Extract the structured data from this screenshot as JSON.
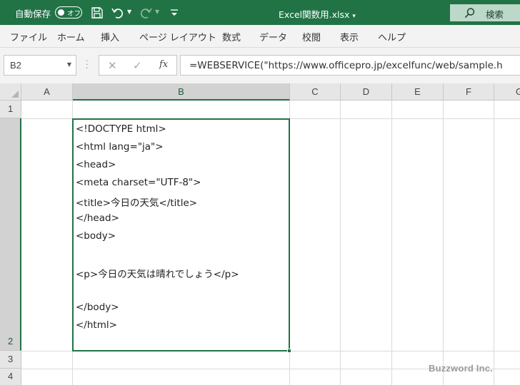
{
  "titlebar": {
    "autosave_label": "自動保存",
    "autosave_state": "オフ",
    "filename": "Excel関数用.xlsx",
    "filename_dropdown": "▾",
    "search_label": "検索",
    "colors": {
      "bg": "#217346",
      "search_bg": "#bcd8c8"
    }
  },
  "menu": {
    "items": [
      "ファイル",
      "ホーム",
      "挿入",
      "ページ レイアウト",
      "数式",
      "データ",
      "校閲",
      "表示",
      "ヘルプ"
    ]
  },
  "formula_bar": {
    "name_box": "B2",
    "cancel_icon": "✕",
    "enter_icon": "✓",
    "fx_label": "fx",
    "formula": "=WEBSERVICE(\"https://www.officepro.jp/excelfunc/web/sample.h"
  },
  "grid": {
    "columns": [
      "A",
      "B",
      "C",
      "D",
      "E",
      "F",
      "G"
    ],
    "selected_column": "B",
    "rows": [
      "1",
      "2",
      "3",
      "4"
    ],
    "selected_row": "2",
    "accent_color": "#217346"
  },
  "cell_B2": {
    "lines": [
      "<!DOCTYPE html>",
      "<html lang=\"ja\">",
      "<head>",
      "<meta charset=\"UTF-8\">",
      "<title>今日の天気</title>",
      "</head>",
      "<body>",
      "",
      "<p>今日の天気は晴れでしょう</p>",
      "",
      "</body>",
      "</html>"
    ]
  },
  "watermark": "Buzzword Inc."
}
